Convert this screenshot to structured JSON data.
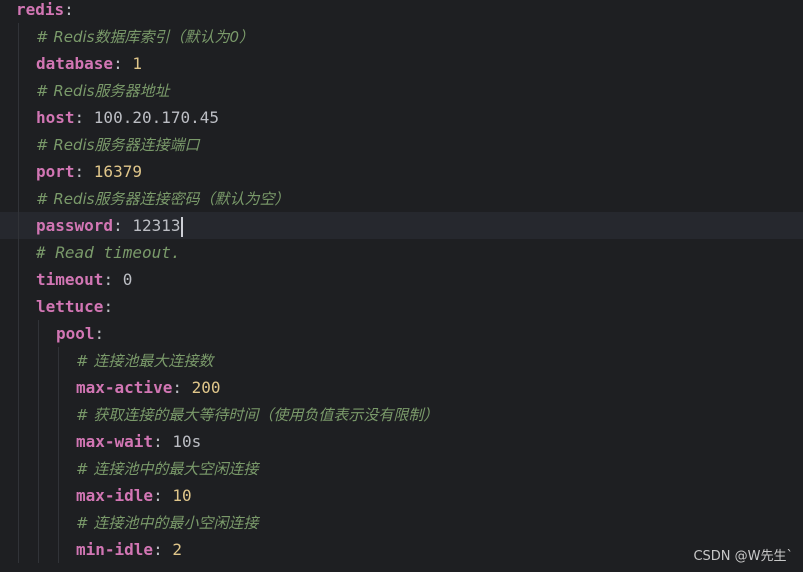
{
  "editor": {
    "lines": [
      {
        "key": "redis",
        "sep": ":",
        "value": "",
        "comment": "",
        "current": false
      },
      {
        "key": "",
        "sep": "",
        "value": "",
        "comment": "# Redis数据库索引（默认为0）",
        "current": false
      },
      {
        "key": "database",
        "sep": ": ",
        "value": "1",
        "comment": "",
        "current": false
      },
      {
        "key": "",
        "sep": "",
        "value": "",
        "comment": "# Redis服务器地址",
        "current": false
      },
      {
        "key": "host",
        "sep": ": ",
        "value": "100.20.170.45",
        "comment": "",
        "current": false
      },
      {
        "key": "",
        "sep": "",
        "value": "",
        "comment": "# Redis服务器连接端口",
        "current": false
      },
      {
        "key": "port",
        "sep": ": ",
        "value": "16379",
        "comment": "",
        "current": false
      },
      {
        "key": "",
        "sep": "",
        "value": "",
        "comment": "# Redis服务器连接密码（默认为空）",
        "current": false
      },
      {
        "key": "password",
        "sep": ": ",
        "value": "12313",
        "comment": "",
        "current": true
      },
      {
        "key": "",
        "sep": "",
        "value": "",
        "comment": "# Read timeout.",
        "current": false
      },
      {
        "key": "timeout",
        "sep": ": ",
        "value": "0",
        "comment": "",
        "current": false
      },
      {
        "key": "lettuce",
        "sep": ":",
        "value": "",
        "comment": "",
        "current": false
      },
      {
        "key": "pool",
        "sep": ":",
        "value": "",
        "comment": "",
        "current": false
      },
      {
        "key": "",
        "sep": "",
        "value": "",
        "comment": "# 连接池最大连接数",
        "current": false
      },
      {
        "key": "max-active",
        "sep": ": ",
        "value": "200",
        "comment": "",
        "current": false
      },
      {
        "key": "",
        "sep": "",
        "value": "",
        "comment": "# 获取连接的最大等待时间（使用负值表示没有限制）",
        "current": false
      },
      {
        "key": "max-wait",
        "sep": ": ",
        "value": "10s",
        "comment": "",
        "current": false
      },
      {
        "key": "",
        "sep": "",
        "value": "",
        "comment": "# 连接池中的最大空闲连接",
        "current": false
      },
      {
        "key": "max-idle",
        "sep": ": ",
        "value": "10",
        "comment": "",
        "current": false
      },
      {
        "key": "",
        "sep": "",
        "value": "",
        "comment": "# 连接池中的最小空闲连接",
        "current": false
      },
      {
        "key": "min-idle",
        "sep": ": ",
        "value": "2",
        "comment": "",
        "current": false
      }
    ]
  },
  "watermark": "CSDN @W先生`",
  "colors": {
    "background": "#1e1f22",
    "key": "#d276b4",
    "comment": "#7a9a6a",
    "number": "#e0c68a",
    "text": "#bcbec4"
  }
}
